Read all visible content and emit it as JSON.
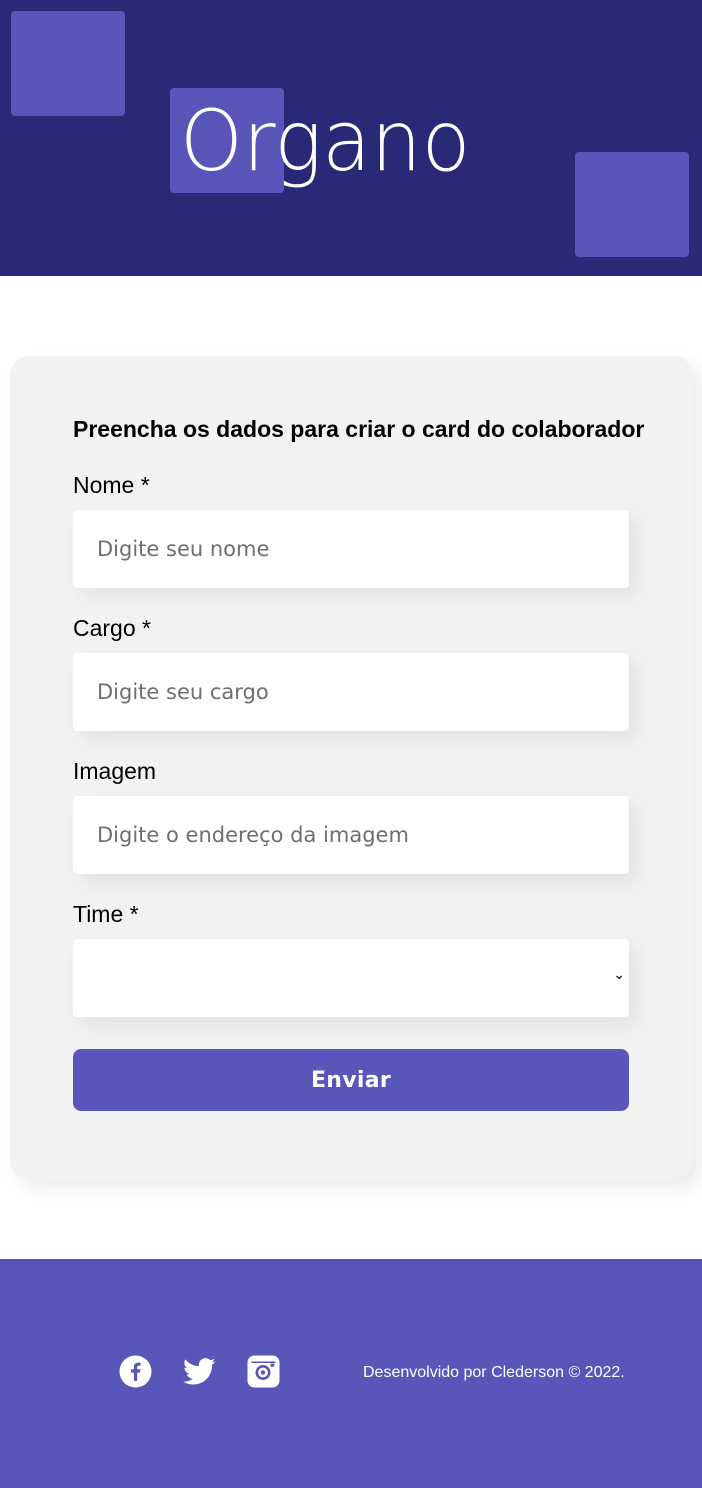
{
  "banner": {
    "logo_text": "Organo",
    "background_color": "#282977",
    "accent_color": "#5856B9"
  },
  "form": {
    "title": "Preencha os dados para criar o card do colaborador",
    "fields": [
      {
        "label": "Nome *",
        "placeholder": "Digite seu nome",
        "value": ""
      },
      {
        "label": "Cargo *",
        "placeholder": "Digite seu cargo",
        "value": ""
      },
      {
        "label": "Imagem",
        "placeholder": "Digite o endereço da imagem",
        "value": ""
      }
    ],
    "team": {
      "label": "Time *",
      "selected": ""
    },
    "submit_label": "Enviar"
  },
  "footer": {
    "social_icons": [
      "facebook-icon",
      "twitter-icon",
      "instagram-icon"
    ],
    "credits": "Desenvolvido por Clederson © 2022.",
    "background_color": "#5856B9"
  }
}
